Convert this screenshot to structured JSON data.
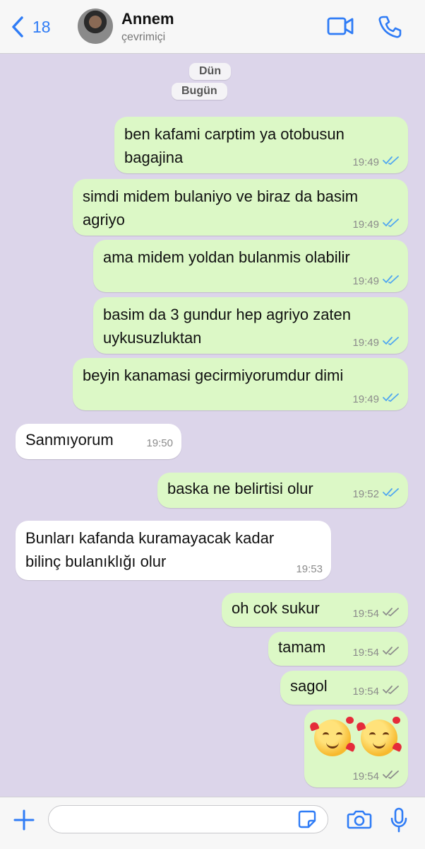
{
  "header": {
    "back_count": "18",
    "contact_name": "Annem",
    "status": "çevrimiçi"
  },
  "date_labels": [
    "Dün",
    "Bugün"
  ],
  "messages": [
    {
      "dir": "out",
      "text": "ben kafami carptim ya otobusun bagajina",
      "time": "19:49",
      "read": true
    },
    {
      "dir": "out",
      "text": "simdi midem bulaniyo ve biraz da basim agriyo",
      "time": "19:49",
      "read": true
    },
    {
      "dir": "out",
      "text": "ama midem yoldan bulanmis olabilir",
      "time": "19:49",
      "read": true
    },
    {
      "dir": "out",
      "text": "basim da 3 gundur hep agriyo zaten uykusuzluktan",
      "time": "19:49",
      "read": true
    },
    {
      "dir": "out",
      "text": "beyin kanamasi gecirmiyorumdur dimi",
      "time": "19:49",
      "read": true
    },
    {
      "dir": "in",
      "text": "Sanmıyorum",
      "time": "19:50"
    },
    {
      "dir": "out",
      "text": "baska ne belirtisi olur",
      "time": "19:52",
      "read": true
    },
    {
      "dir": "in",
      "text": "Bunları kafanda kuramayacak kadar bilinç bulanıklığı olur",
      "time": "19:53"
    },
    {
      "dir": "out",
      "text": "oh cok sukur",
      "time": "19:54",
      "read": false
    },
    {
      "dir": "out",
      "text": "tamam",
      "time": "19:54",
      "read": false
    },
    {
      "dir": "out",
      "text": "sagol",
      "time": "19:54",
      "read": false
    },
    {
      "dir": "out",
      "emoji": [
        "smiling-face-with-hearts",
        "smiling-face-with-hearts"
      ],
      "time": "19:54",
      "read": false
    }
  ],
  "composer": {
    "value": "",
    "placeholder": ""
  },
  "colors": {
    "accent": "#2f7cf6",
    "outgoing_bubble": "#dcf8c6",
    "incoming_bubble": "#ffffff",
    "chat_background": "#dcd5ea",
    "read_check": "#4fa6f0",
    "unread_check": "#8b8b8b"
  }
}
